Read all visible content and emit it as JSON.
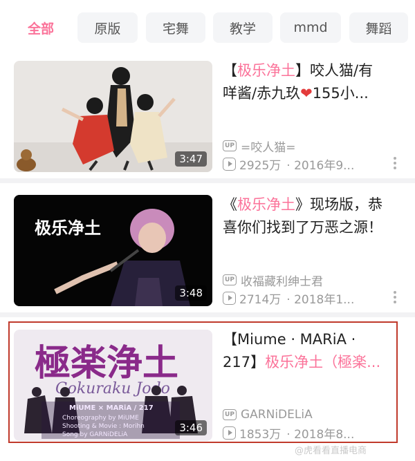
{
  "tabs": [
    {
      "label": "全部",
      "active": true
    },
    {
      "label": "原版",
      "active": false
    },
    {
      "label": "宅舞",
      "active": false
    },
    {
      "label": "教学",
      "active": false
    },
    {
      "label": "mmd",
      "active": false
    },
    {
      "label": "舞蹈",
      "active": false
    }
  ],
  "videos": [
    {
      "title_line1_prefix": "【",
      "title_line1_highlight": "极乐净土",
      "title_line1_rest": "】咬人猫/有",
      "title_line2": "咩酱/赤九玖",
      "title_heart": "❤",
      "title_line2_rest": "155小...",
      "uploader": "=咬人猫=",
      "views": "2925万",
      "date": "· 2016年9...",
      "duration": "3:47"
    },
    {
      "title_line1_prefix": "《",
      "title_line1_highlight": "极乐净土",
      "title_line1_rest": "》现场版，恭",
      "title_line2": "喜你们找到了万恶之源！",
      "uploader": "收福藏利绅士君",
      "views": "2714万",
      "date": "· 2018年1...",
      "duration": "3:48",
      "thumb_caption": "极乐净土"
    },
    {
      "title_line1": "【Miume · MARiA ·",
      "title_line2_prefix": "217】",
      "title_line2_highlight": "极乐净土",
      "title_line2_rest": "（極楽...",
      "uploader": "GARNiDELiA",
      "views": "1853万",
      "date": "· 2018年8...",
      "duration": "3:46",
      "thumb_title": "極楽浄土",
      "thumb_subtitle": "Gokuraku Jodo",
      "thumb_credit1": "MiUME × MARiA / 217",
      "thumb_credit2": "Choreography by MiUME",
      "thumb_credit3": "Shooting & Movie : Morihn",
      "thumb_credit4": "Song by GARNiDELiA"
    }
  ],
  "icons": {
    "up_badge_text": "UP",
    "more": "more-vertical-icon",
    "play": "play-count-icon"
  },
  "watermark": "@虎看看直播电商",
  "colors": {
    "accent": "#fb7299",
    "highlight_border": "#c0392b"
  }
}
